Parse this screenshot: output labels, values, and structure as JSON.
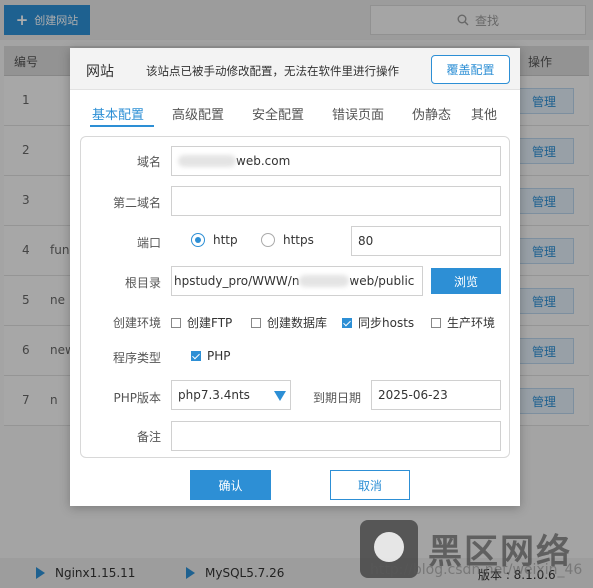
{
  "toolbar": {
    "create_label": "创建网站",
    "search_label": "查找"
  },
  "table": {
    "col_num": "编号",
    "col_op": "操作",
    "rows": [
      {
        "idx": "1",
        "name": "",
        "op": "管理"
      },
      {
        "idx": "2",
        "name": "",
        "op": "管理"
      },
      {
        "idx": "3",
        "name": "",
        "op": "管理"
      },
      {
        "idx": "4",
        "name": "fun",
        "op": "管理"
      },
      {
        "idx": "5",
        "name": "ne",
        "op": "管理"
      },
      {
        "idx": "6",
        "name": "new",
        "op": "管理"
      },
      {
        "idx": "7",
        "name": "n",
        "op": "管理"
      }
    ]
  },
  "bottom": {
    "nginx": "Nginx1.15.11",
    "mysql": "MySQL5.7.26",
    "version": "版本 : 8.1.0.6"
  },
  "dialog": {
    "title": "网站",
    "note": "该站点已被手动修改配置，无法在软件里进行操作",
    "override_label": "覆盖配置",
    "tabs": [
      "基本配置",
      "高级配置",
      "安全配置",
      "错误页面",
      "伪静态",
      "其他"
    ],
    "fields": {
      "domain_label": "域名",
      "domain_value": "web.com",
      "second_domain_label": "第二域名",
      "second_domain_value": "",
      "port_label": "端口",
      "http_label": "http",
      "https_label": "https",
      "port_value": "80",
      "root_label": "根目录",
      "root_prefix": "hpstudy_pro/WWW/n",
      "root_suffix": "web/public",
      "browse_label": "浏览",
      "env_label": "创建环境",
      "env_options": [
        "创建FTP",
        "创建数据库",
        "同步hosts",
        "生产环境"
      ],
      "program_label": "程序类型",
      "program_option": "PHP",
      "php_label": "PHP版本",
      "php_value": "php7.3.4nts",
      "expire_label": "到期日期",
      "expire_value": "2025-06-23",
      "note_label": "备注",
      "note_value": ""
    },
    "ok_label": "确认",
    "cancel_label": "取消"
  },
  "watermark": {
    "text": "黑区网络",
    "url": "http://blog.csdn.net/weixin_46"
  },
  "colors": {
    "accent": "#2d8fd5",
    "overlay": "rgba(0,0,0,0.32)"
  },
  "state": {
    "active_tab": "基本配置",
    "http_selected": true,
    "https_selected": false,
    "env_checked": [
      false,
      false,
      true,
      false
    ],
    "php_checked": true
  }
}
